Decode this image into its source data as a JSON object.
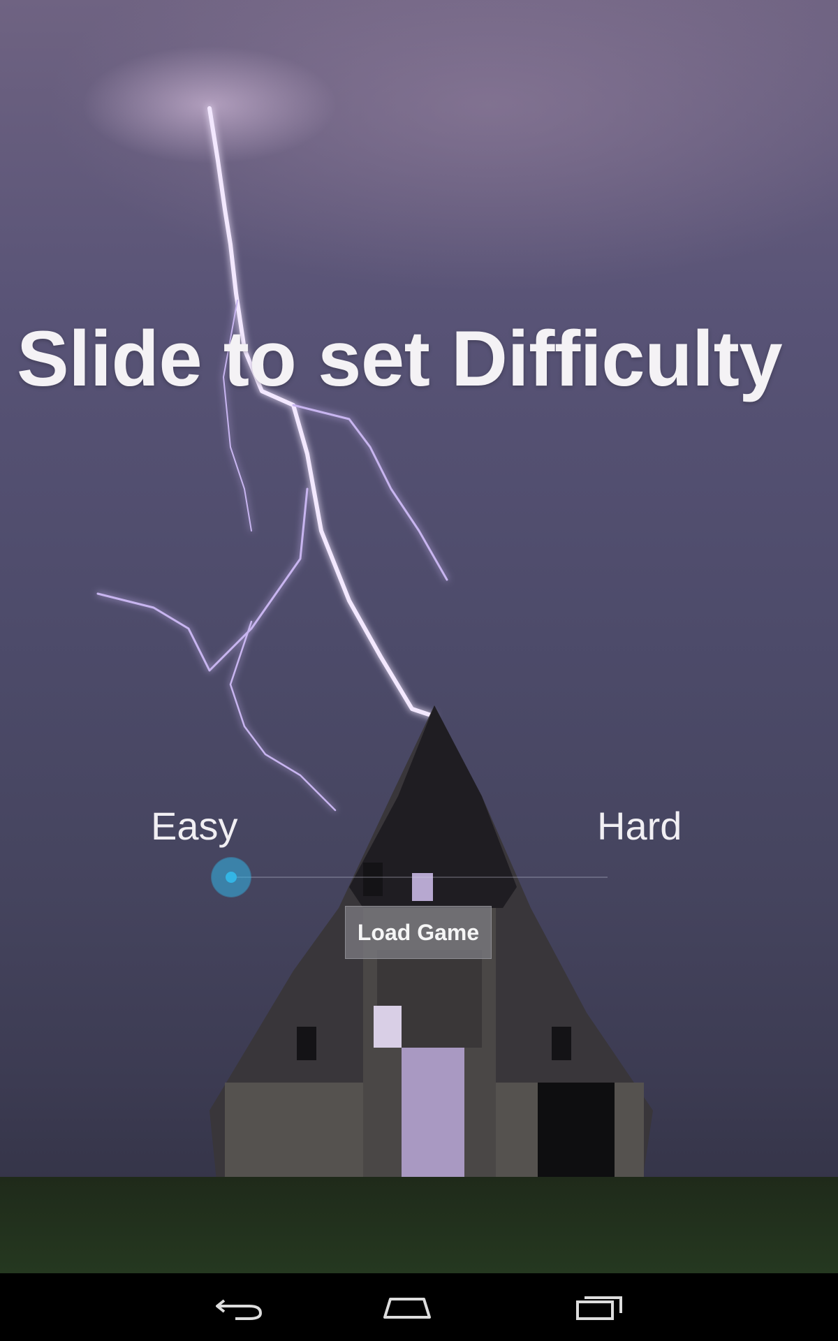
{
  "screen": {
    "title": "Slide to set Difficulty",
    "slider": {
      "min_label": "Easy",
      "max_label": "Hard",
      "value": 0,
      "accent_color": "#33b5e5"
    },
    "load_button": {
      "label": "Load Game"
    },
    "background": {
      "subject": "lightning strike over old barn"
    }
  },
  "nav_bar": {
    "back_icon": "back-arrow-icon",
    "home_icon": "home-icon",
    "recents_icon": "recent-apps-icon"
  }
}
